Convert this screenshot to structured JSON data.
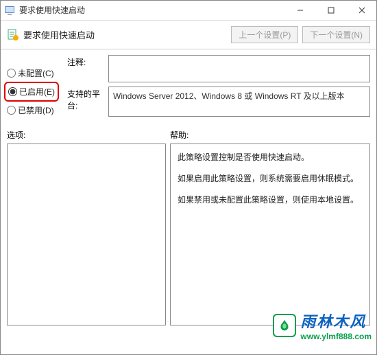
{
  "window": {
    "title": "要求使用快速启动"
  },
  "toolbar": {
    "title": "要求使用快速启动",
    "prev": "上一个设置(P)",
    "next": "下一个设置(N)"
  },
  "radios": {
    "not_configured": "未配置(C)",
    "enabled": "已启用(E)",
    "disabled": "已禁用(D)"
  },
  "labels": {
    "comment": "注释:",
    "platform": "支持的平台:",
    "options": "选项:",
    "help": "帮助:"
  },
  "platform_text": "Windows Server 2012、Windows 8 或 Windows RT 及以上版本",
  "help": {
    "p1": "此策略设置控制是否使用快速启动。",
    "p2": "如果启用此策略设置，则系统需要启用休眠模式。",
    "p3": "如果禁用或未配置此策略设置，则使用本地设置。"
  },
  "watermark": {
    "cn": "雨林木风",
    "url": "www.ylmf888.com"
  }
}
